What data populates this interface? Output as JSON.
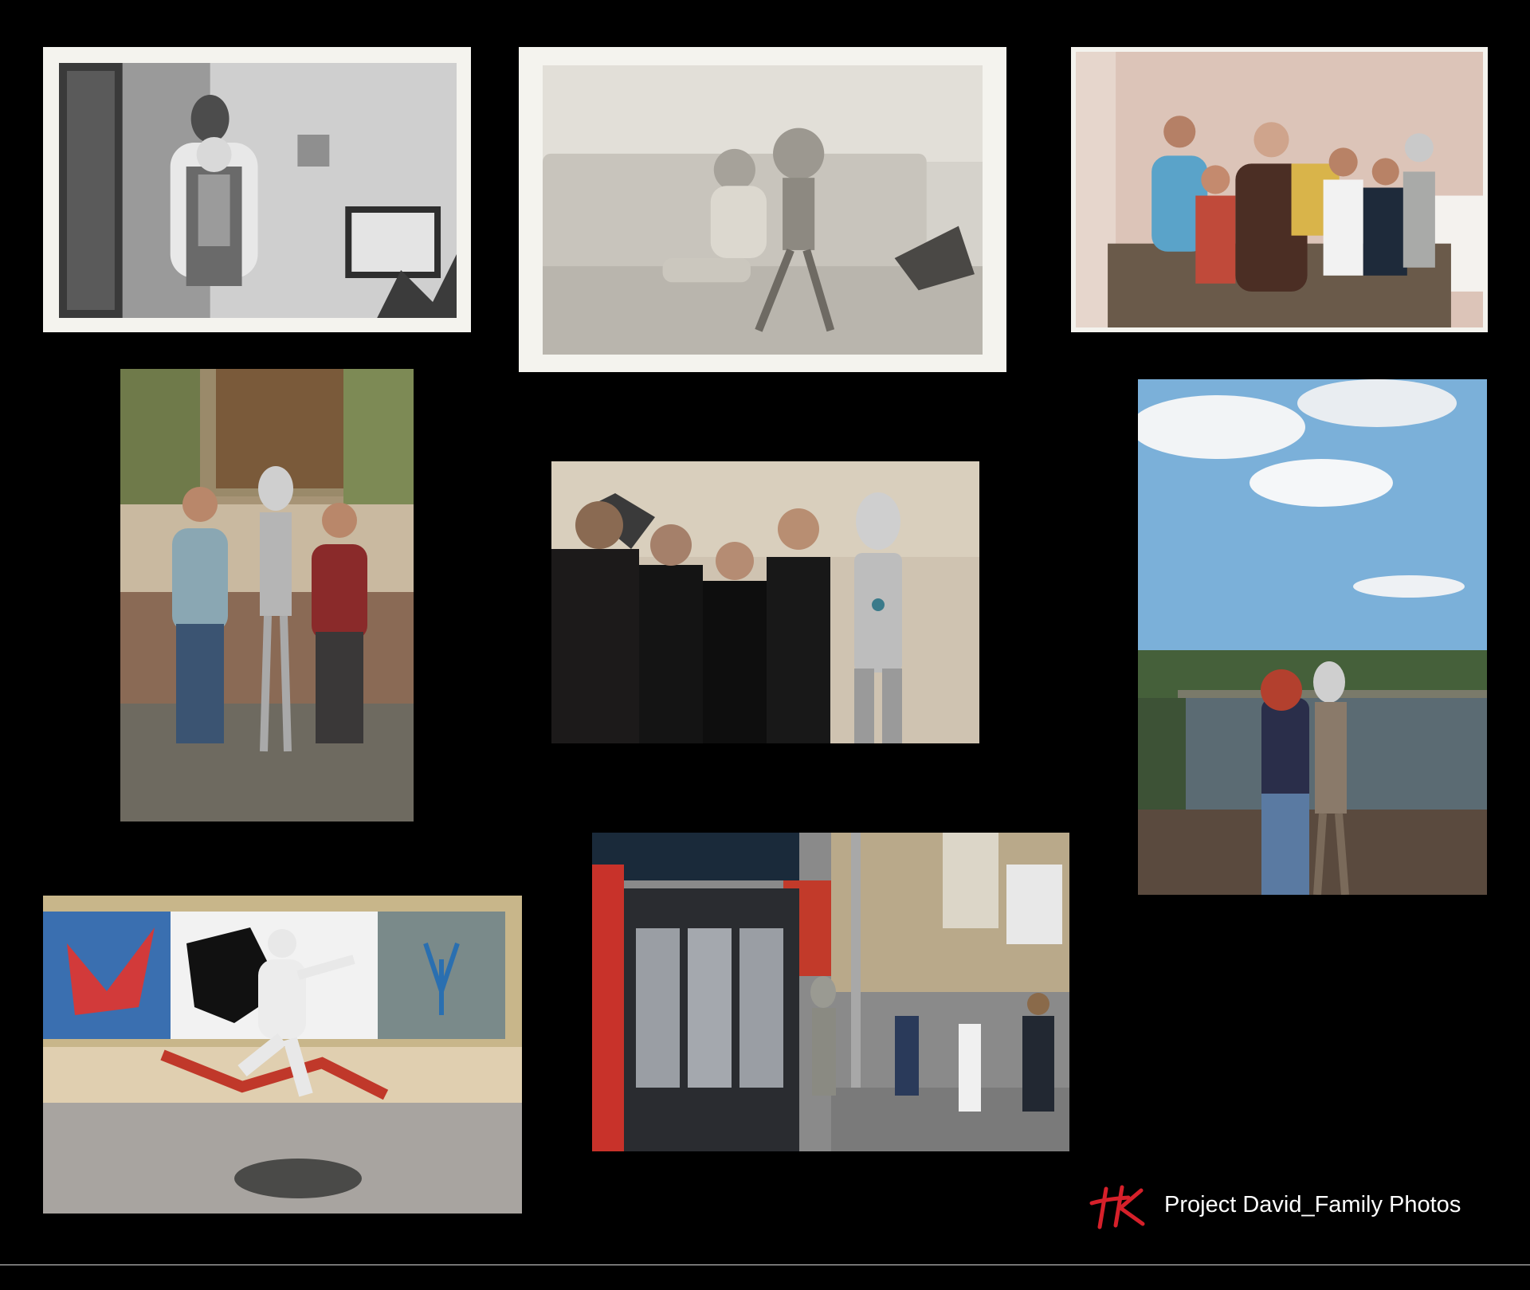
{
  "caption": {
    "text": "Project David_Family Photos"
  },
  "logo": {
    "icon": "hk-logo-icon",
    "color": "#d6202a"
  },
  "photos": [
    {
      "id": "photo-1",
      "style": "black-and-white print with white border"
    },
    {
      "id": "photo-2",
      "style": "black-and-white print with white border"
    },
    {
      "id": "photo-3",
      "style": "color print with white border"
    },
    {
      "id": "photo-4",
      "style": "faded color print"
    },
    {
      "id": "photo-5",
      "style": "color print, dark interior"
    },
    {
      "id": "photo-6",
      "style": "color print, sky and river"
    },
    {
      "id": "photo-7",
      "style": "color print, graffiti wall"
    },
    {
      "id": "photo-8",
      "style": "color print, city street"
    }
  ],
  "colors": {
    "background": "#000000",
    "caption_text": "#ffffff",
    "footer_rule": "#d8d8d8"
  }
}
